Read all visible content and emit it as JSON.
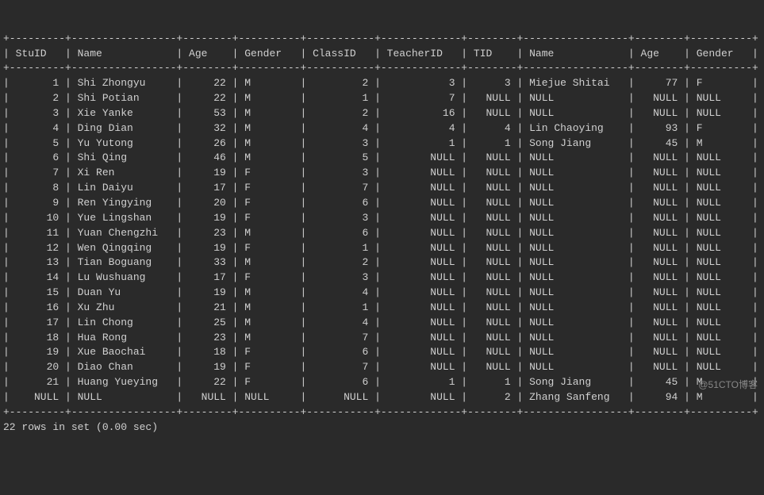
{
  "headers": [
    "StuID",
    "Name",
    "Age",
    "Gender",
    "ClassID",
    "TeacherID",
    "TID",
    "Name",
    "Age",
    "Gender"
  ],
  "rows": [
    {
      "StuID": "1",
      "Name": "Shi Zhongyu",
      "Age": "22",
      "Gender": "M",
      "ClassID": "2",
      "TeacherID": "3",
      "TID": "3",
      "TName": "Miejue Shitai",
      "TAge": "77",
      "TGender": "F"
    },
    {
      "StuID": "2",
      "Name": "Shi Potian",
      "Age": "22",
      "Gender": "M",
      "ClassID": "1",
      "TeacherID": "7",
      "TID": "NULL",
      "TName": "NULL",
      "TAge": "NULL",
      "TGender": "NULL"
    },
    {
      "StuID": "3",
      "Name": "Xie Yanke",
      "Age": "53",
      "Gender": "M",
      "ClassID": "2",
      "TeacherID": "16",
      "TID": "NULL",
      "TName": "NULL",
      "TAge": "NULL",
      "TGender": "NULL"
    },
    {
      "StuID": "4",
      "Name": "Ding Dian",
      "Age": "32",
      "Gender": "M",
      "ClassID": "4",
      "TeacherID": "4",
      "TID": "4",
      "TName": "Lin Chaoying",
      "TAge": "93",
      "TGender": "F"
    },
    {
      "StuID": "5",
      "Name": "Yu Yutong",
      "Age": "26",
      "Gender": "M",
      "ClassID": "3",
      "TeacherID": "1",
      "TID": "1",
      "TName": "Song Jiang",
      "TAge": "45",
      "TGender": "M"
    },
    {
      "StuID": "6",
      "Name": "Shi Qing",
      "Age": "46",
      "Gender": "M",
      "ClassID": "5",
      "TeacherID": "NULL",
      "TID": "NULL",
      "TName": "NULL",
      "TAge": "NULL",
      "TGender": "NULL"
    },
    {
      "StuID": "7",
      "Name": "Xi Ren",
      "Age": "19",
      "Gender": "F",
      "ClassID": "3",
      "TeacherID": "NULL",
      "TID": "NULL",
      "TName": "NULL",
      "TAge": "NULL",
      "TGender": "NULL"
    },
    {
      "StuID": "8",
      "Name": "Lin Daiyu",
      "Age": "17",
      "Gender": "F",
      "ClassID": "7",
      "TeacherID": "NULL",
      "TID": "NULL",
      "TName": "NULL",
      "TAge": "NULL",
      "TGender": "NULL"
    },
    {
      "StuID": "9",
      "Name": "Ren Yingying",
      "Age": "20",
      "Gender": "F",
      "ClassID": "6",
      "TeacherID": "NULL",
      "TID": "NULL",
      "TName": "NULL",
      "TAge": "NULL",
      "TGender": "NULL"
    },
    {
      "StuID": "10",
      "Name": "Yue Lingshan",
      "Age": "19",
      "Gender": "F",
      "ClassID": "3",
      "TeacherID": "NULL",
      "TID": "NULL",
      "TName": "NULL",
      "TAge": "NULL",
      "TGender": "NULL"
    },
    {
      "StuID": "11",
      "Name": "Yuan Chengzhi",
      "Age": "23",
      "Gender": "M",
      "ClassID": "6",
      "TeacherID": "NULL",
      "TID": "NULL",
      "TName": "NULL",
      "TAge": "NULL",
      "TGender": "NULL"
    },
    {
      "StuID": "12",
      "Name": "Wen Qingqing",
      "Age": "19",
      "Gender": "F",
      "ClassID": "1",
      "TeacherID": "NULL",
      "TID": "NULL",
      "TName": "NULL",
      "TAge": "NULL",
      "TGender": "NULL"
    },
    {
      "StuID": "13",
      "Name": "Tian Boguang",
      "Age": "33",
      "Gender": "M",
      "ClassID": "2",
      "TeacherID": "NULL",
      "TID": "NULL",
      "TName": "NULL",
      "TAge": "NULL",
      "TGender": "NULL"
    },
    {
      "StuID": "14",
      "Name": "Lu Wushuang",
      "Age": "17",
      "Gender": "F",
      "ClassID": "3",
      "TeacherID": "NULL",
      "TID": "NULL",
      "TName": "NULL",
      "TAge": "NULL",
      "TGender": "NULL"
    },
    {
      "StuID": "15",
      "Name": "Duan Yu",
      "Age": "19",
      "Gender": "M",
      "ClassID": "4",
      "TeacherID": "NULL",
      "TID": "NULL",
      "TName": "NULL",
      "TAge": "NULL",
      "TGender": "NULL"
    },
    {
      "StuID": "16",
      "Name": "Xu Zhu",
      "Age": "21",
      "Gender": "M",
      "ClassID": "1",
      "TeacherID": "NULL",
      "TID": "NULL",
      "TName": "NULL",
      "TAge": "NULL",
      "TGender": "NULL"
    },
    {
      "StuID": "17",
      "Name": "Lin Chong",
      "Age": "25",
      "Gender": "M",
      "ClassID": "4",
      "TeacherID": "NULL",
      "TID": "NULL",
      "TName": "NULL",
      "TAge": "NULL",
      "TGender": "NULL"
    },
    {
      "StuID": "18",
      "Name": "Hua Rong",
      "Age": "23",
      "Gender": "M",
      "ClassID": "7",
      "TeacherID": "NULL",
      "TID": "NULL",
      "TName": "NULL",
      "TAge": "NULL",
      "TGender": "NULL"
    },
    {
      "StuID": "19",
      "Name": "Xue Baochai",
      "Age": "18",
      "Gender": "F",
      "ClassID": "6",
      "TeacherID": "NULL",
      "TID": "NULL",
      "TName": "NULL",
      "TAge": "NULL",
      "TGender": "NULL"
    },
    {
      "StuID": "20",
      "Name": "Diao Chan",
      "Age": "19",
      "Gender": "F",
      "ClassID": "7",
      "TeacherID": "NULL",
      "TID": "NULL",
      "TName": "NULL",
      "TAge": "NULL",
      "TGender": "NULL"
    },
    {
      "StuID": "21",
      "Name": "Huang Yueying",
      "Age": "22",
      "Gender": "F",
      "ClassID": "6",
      "TeacherID": "1",
      "TID": "1",
      "TName": "Song Jiang",
      "TAge": "45",
      "TGender": "M"
    },
    {
      "StuID": "NULL",
      "Name": "NULL",
      "Age": "NULL",
      "Gender": "NULL",
      "ClassID": "NULL",
      "TeacherID": "NULL",
      "TID": "2",
      "TName": "Zhang Sanfeng",
      "TAge": "94",
      "TGender": "M"
    }
  ],
  "footer": "22 rows in set (0.00 sec)",
  "watermark": "@51CTO博客",
  "colwidths": {
    "StuID": 7,
    "Name": 15,
    "Age": 6,
    "Gender": 8,
    "ClassID": 9,
    "TeacherID": 11,
    "TID": 6,
    "TName": 15,
    "TAge": 6,
    "TGender": 8
  }
}
